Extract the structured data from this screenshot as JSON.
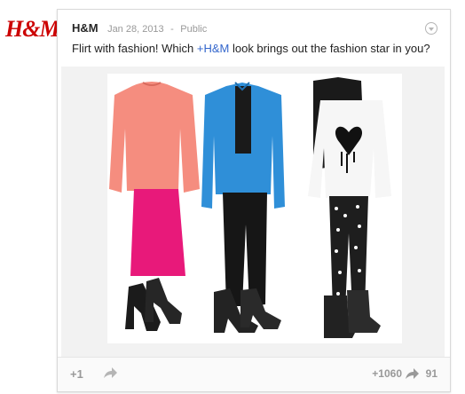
{
  "brand": {
    "logo_text": "H&M"
  },
  "post": {
    "author": "H&M",
    "date": "Jan 28, 2013",
    "separator": "-",
    "visibility": "Public",
    "text_before": "Flirt with fashion! Which ",
    "mention": "+H&M",
    "text_after": " look brings out the fashion star in you?"
  },
  "footer": {
    "plus_one_label": "+1",
    "plus_count": "+1060",
    "share_count": "91"
  },
  "colors": {
    "brand_red": "#cc0000",
    "link_blue": "#3366cc",
    "muted": "#999999"
  },
  "icons": [
    "share-icon",
    "menu-chevron-icon"
  ]
}
